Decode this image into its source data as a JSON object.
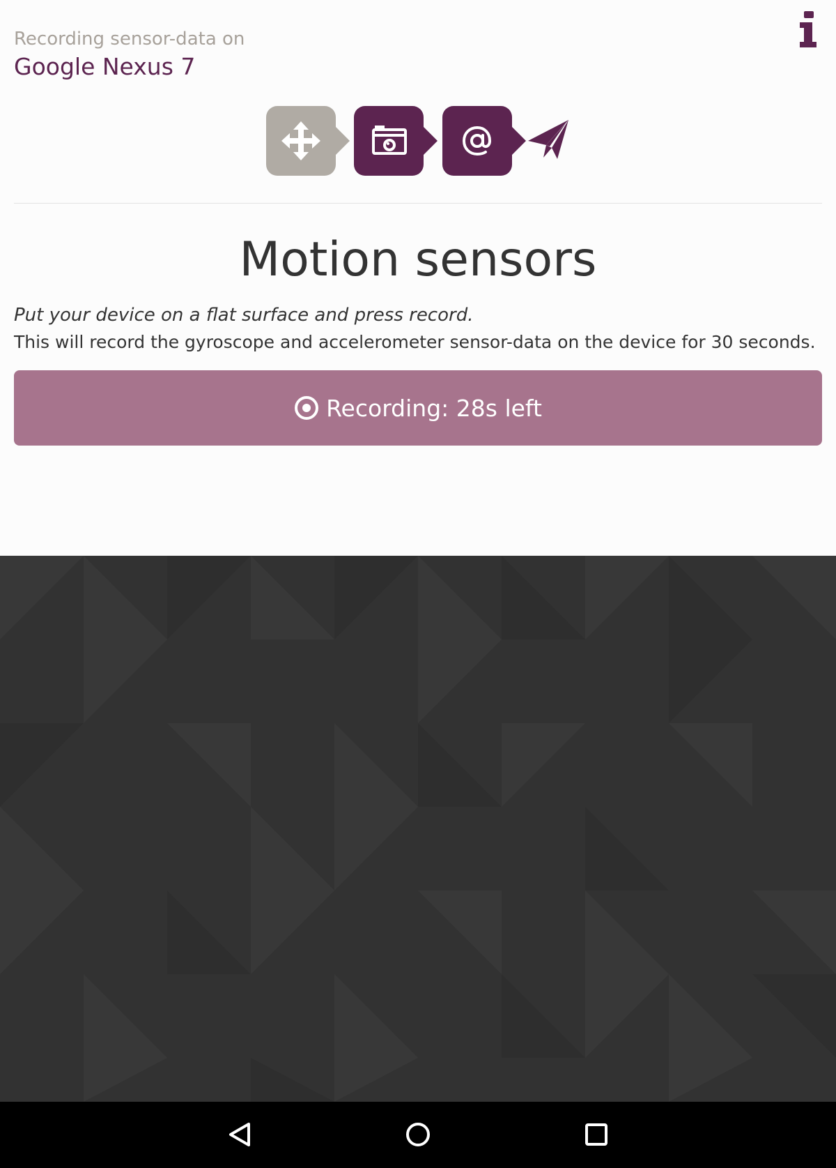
{
  "header": {
    "subtitle": "Recording sensor-data on",
    "device_name": "Google Nexus 7",
    "info_icon": "info-icon"
  },
  "steps": [
    {
      "icon": "move-icon",
      "state": "active"
    },
    {
      "icon": "camera-icon",
      "state": "upcoming"
    },
    {
      "icon": "at-sign-icon",
      "state": "upcoming"
    },
    {
      "icon": "paper-plane-icon",
      "state": "upcoming"
    }
  ],
  "main": {
    "title": "Motion sensors",
    "instruction": "Put your device on a flat surface and press record.",
    "description": "This will record the gyroscope and accelerometer sensor-data on the device for 30 seconds.",
    "record_button": {
      "icon": "record-icon",
      "label": "Recording: 28s left"
    }
  },
  "nav_bar": {
    "back_icon": "back-icon",
    "home_icon": "home-icon",
    "recents_icon": "recents-icon"
  },
  "colors": {
    "brand": "#5c2450",
    "muted": "#b0aba4",
    "recording_button": "#a7748d",
    "dark_background": "#323232"
  }
}
